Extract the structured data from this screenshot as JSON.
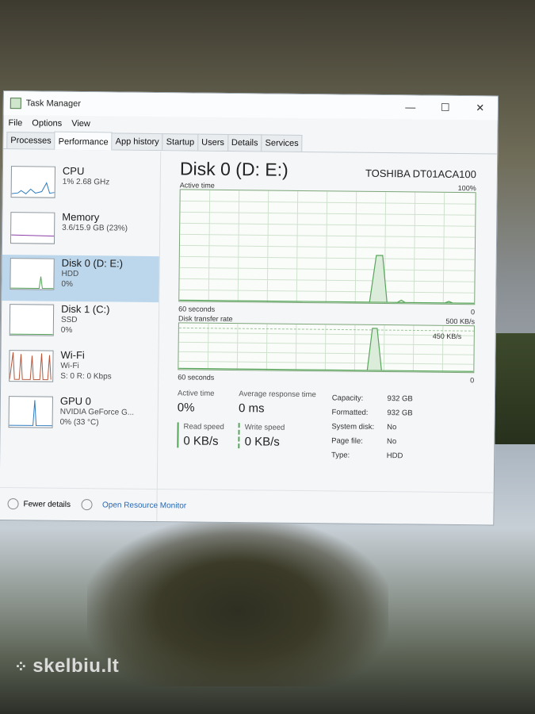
{
  "window": {
    "title": "Task Manager",
    "controls": [
      "—",
      "☐",
      "✕"
    ]
  },
  "menu": [
    "File",
    "Options",
    "View"
  ],
  "tabs": [
    "Processes",
    "Performance",
    "App history",
    "Startup",
    "Users",
    "Details",
    "Services"
  ],
  "active_tab": "Performance",
  "sidebar": [
    {
      "name": "CPU",
      "sub1": "1% 2.68 GHz",
      "sub2": ""
    },
    {
      "name": "Memory",
      "sub1": "3.6/15.9 GB (23%)",
      "sub2": ""
    },
    {
      "name": "Disk 0 (D: E:)",
      "sub1": "HDD",
      "sub2": "0%"
    },
    {
      "name": "Disk 1 (C:)",
      "sub1": "SSD",
      "sub2": "0%"
    },
    {
      "name": "Wi-Fi",
      "sub1": "Wi-Fi",
      "sub2": "S: 0 R: 0 Kbps"
    },
    {
      "name": "GPU 0",
      "sub1": "NVIDIA GeForce G...",
      "sub2": "0% (33 °C)"
    }
  ],
  "main": {
    "title": "Disk 0 (D: E:)",
    "model": "TOSHIBA DT01ACA100",
    "chart1": {
      "label": "Active time",
      "max": "100%",
      "time": "60 seconds",
      "min": "0"
    },
    "chart2": {
      "label": "Disk transfer rate",
      "max": "500 KB/s",
      "inner": "450 KB/s",
      "time": "60 seconds",
      "min": "0"
    },
    "stats": {
      "active_time_label": "Active time",
      "active_time": "0%",
      "avg_resp_label": "Average response time",
      "avg_resp": "0 ms",
      "read_label": "Read speed",
      "read": "0 KB/s",
      "write_label": "Write speed",
      "write": "0 KB/s"
    },
    "props": [
      {
        "k": "Capacity:",
        "v": "932 GB"
      },
      {
        "k": "Formatted:",
        "v": "932 GB"
      },
      {
        "k": "System disk:",
        "v": "No"
      },
      {
        "k": "Page file:",
        "v": "No"
      },
      {
        "k": "Type:",
        "v": "HDD"
      }
    ]
  },
  "footer": {
    "fewer": "Fewer details",
    "monitor": "Open Resource Monitor"
  },
  "watermark": "skelbiu.lt",
  "colors": {
    "accent": "#57a55a",
    "selected": "#bcd7ec"
  }
}
